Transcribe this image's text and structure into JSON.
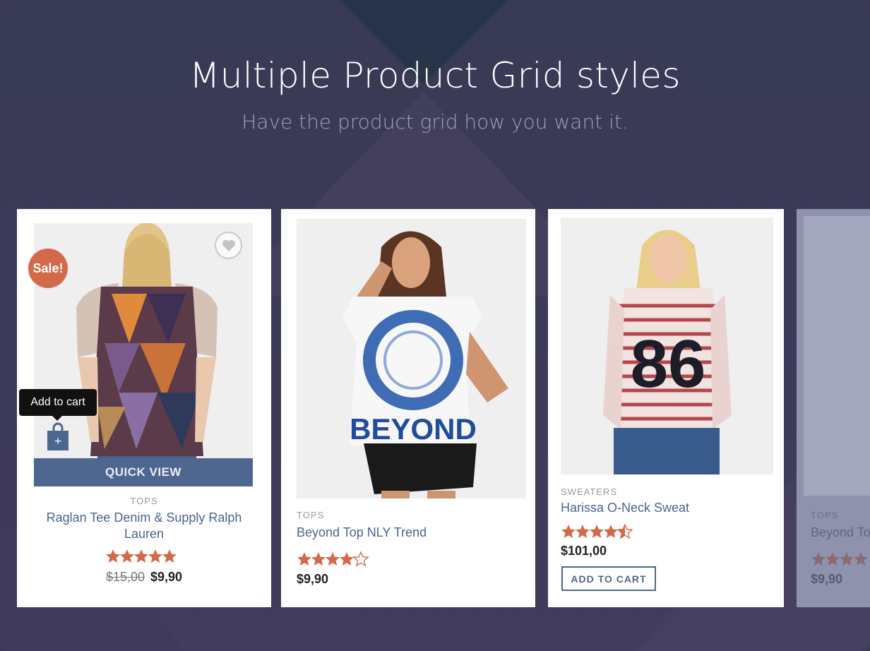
{
  "header": {
    "title": "Multiple Product Grid styles",
    "subtitle": "Have the product grid how you want it."
  },
  "products": [
    {
      "category": "TOPS",
      "name": "Raglan Tee Denim & Supply Ralph Lauren",
      "rating": 5,
      "old_price": "$15,00",
      "price": "$9,90",
      "badge": "Sale!",
      "tooltip": "Add to cart",
      "quick_view": "QUICK VIEW"
    },
    {
      "category": "TOPS",
      "name": "Beyond Top NLY Trend",
      "rating": 4,
      "price": "$9,90",
      "print_text": "BEYOND"
    },
    {
      "category": "SWEATERS",
      "name": "Harissa O-Neck Sweat",
      "rating": 4.5,
      "price": "$101,00",
      "button": "ADD TO CART",
      "print_text": "86"
    },
    {
      "category": "TOPS",
      "name": "Beyond To",
      "rating": 4,
      "price": "$9,90"
    }
  ],
  "colors": {
    "accent": "#4e678f",
    "sale": "#d26a49",
    "star": "#d26a49",
    "background": "#3a3a55"
  }
}
